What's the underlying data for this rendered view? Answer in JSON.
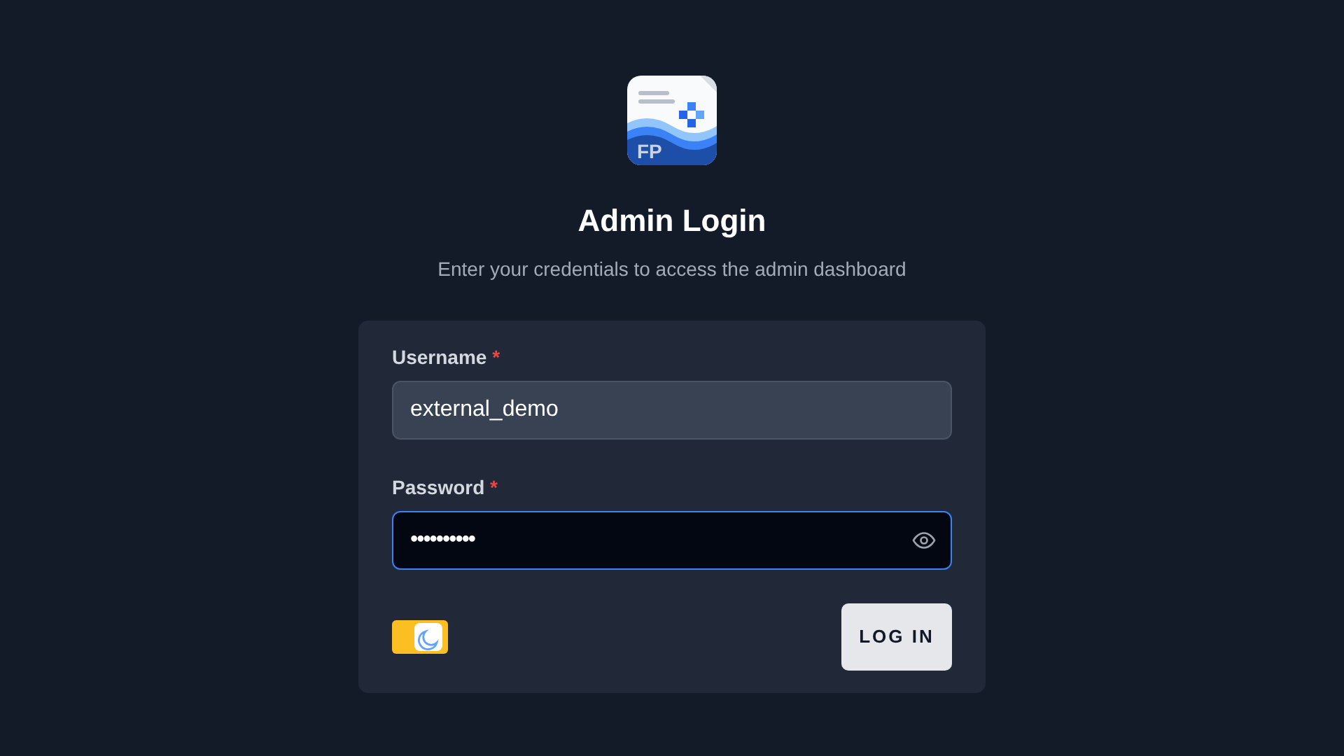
{
  "logo": {
    "text": "FP"
  },
  "title": "Admin Login",
  "subtitle": "Enter your credentials to access the admin dashboard",
  "fields": [
    {
      "label": "Username",
      "required_mark": "*",
      "value": "external_demo",
      "focused": false,
      "kind": "text"
    },
    {
      "label": "Password",
      "required_mark": "*",
      "value": "••••••••••",
      "focused": true,
      "kind": "password"
    }
  ],
  "theme_toggle": {
    "on": true
  },
  "login_button": "LOG IN"
}
